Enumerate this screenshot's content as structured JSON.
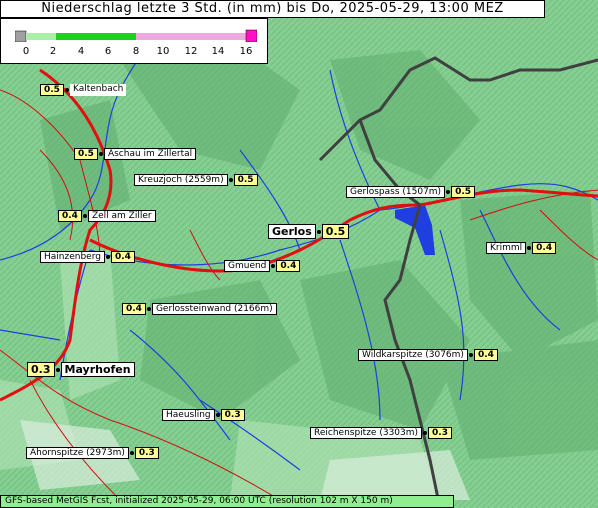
{
  "title": "Niederschlag letzte 3 Std. (in mm) bis Do, 2025-05-29, 13:00 MEZ",
  "legend": {
    "ticks": [
      "0",
      "2",
      "4",
      "6",
      "8",
      "10",
      "12",
      "14",
      "16"
    ],
    "colors": {
      "zero": "#a0a0a0",
      "low": "#00c800",
      "mid": "#40e040",
      "pink": "#f0a0e0",
      "max": "#ff00c8"
    }
  },
  "footer": "GFS-based MetGIS Fcst, initialized 2025-05-29, 06:00 UTC  (resolution 102 m X 150 m)",
  "places": [
    {
      "name": "Kaltenbach",
      "value": "0.5"
    },
    {
      "name": "Aschau im Zillertal",
      "value": "0.5"
    },
    {
      "name": "Kreuzjoch (2559m)",
      "value": "0.5"
    },
    {
      "name": "Zell am Ziller",
      "value": "0.4"
    },
    {
      "name": "Gerlospass (1507m)",
      "value": "0.5"
    },
    {
      "name": "Gerlos",
      "value": "0.5"
    },
    {
      "name": "Hainzenberg",
      "value": "0.4"
    },
    {
      "name": "Gmuend",
      "value": "0.4"
    },
    {
      "name": "Krimml",
      "value": "0.4"
    },
    {
      "name": "Gerlossteinwand (2166m)",
      "value": "0.4"
    },
    {
      "name": "Wildkarspitze (3076m)",
      "value": "0.4"
    },
    {
      "name": "Mayrhofen",
      "value": "0.3"
    },
    {
      "name": "Haeusling",
      "value": "0.3"
    },
    {
      "name": "Reichenspitze (3303m)",
      "value": "0.3"
    },
    {
      "name": "Ahornspitze (2973m)",
      "value": "0.3"
    }
  ]
}
